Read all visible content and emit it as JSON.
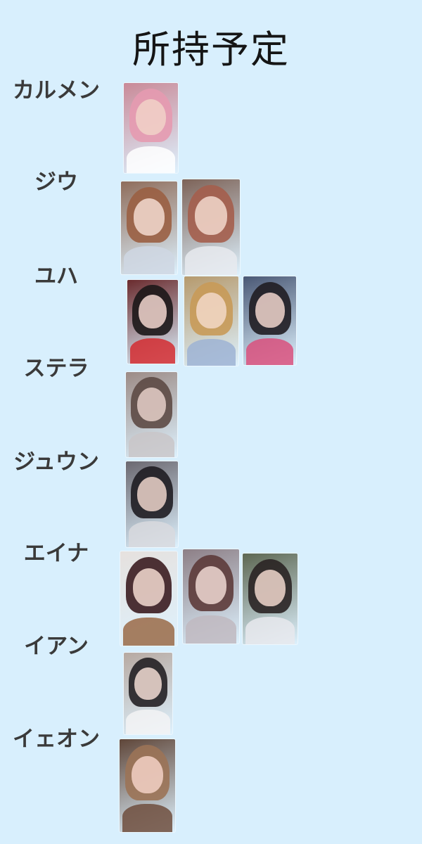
{
  "title": "所持予定",
  "members": [
    {
      "name": "カルメン",
      "cards": [
        {
          "bg": "#c98a98",
          "hair": "#e69ab0",
          "face": "#f1d2c8",
          "top": "#ffffff"
        }
      ]
    },
    {
      "name": "ジウ",
      "cards": [
        {
          "bg": "#8f6d5b",
          "hair": "#9a5f42",
          "face": "#f3dbd0",
          "top": "#cfd7e3"
        },
        {
          "bg": "#7d6358",
          "hair": "#a45e4c",
          "face": "#f2d8cd",
          "top": "#e8eaee"
        }
      ]
    },
    {
      "name": "ユハ",
      "cards": [
        {
          "bg": "#6a2b2e",
          "hair": "#1c1718",
          "face": "#f2d6cf",
          "top": "#d32b30"
        },
        {
          "bg": "#b69a6d",
          "hair": "#c89a58",
          "face": "#f2d8c8",
          "top": "#9db3d3"
        },
        {
          "bg": "#4a5875",
          "hair": "#201d22",
          "face": "#f0d5cd",
          "top": "#d9507d"
        }
      ]
    },
    {
      "name": "ステラ",
      "cards": [
        {
          "bg": "#9c8b86",
          "hair": "#5d4a45",
          "face": "#e5cfc8",
          "top": "#c9c6c8"
        }
      ]
    },
    {
      "name": "ジュウン",
      "cards": [
        {
          "bg": "#6b6870",
          "hair": "#1f1d22",
          "face": "#ecd3ca",
          "top": "#d8d9de"
        }
      ]
    },
    {
      "name": "エイナ",
      "cards": [
        {
          "bg": "#e6e1de",
          "hair": "#3b1c20",
          "face": "#f3dad1",
          "top": "#9a6a46"
        },
        {
          "bg": "#8d7f86",
          "hair": "#5d3b3a",
          "face": "#eed8d2",
          "top": "#bfb8bf"
        },
        {
          "bg": "#5d6752",
          "hair": "#2a2424",
          "face": "#f0d7cd",
          "top": "#e7e9ed"
        }
      ]
    },
    {
      "name": "イアン",
      "cards": [
        {
          "bg": "#b7a9a1",
          "hair": "#232024",
          "face": "#f2dcd4",
          "top": "#f3f3f5"
        }
      ]
    },
    {
      "name": "イェオン",
      "cards": [
        {
          "bg": "#5f4639",
          "hair": "#9b7357",
          "face": "#f3d1c6",
          "top": "#6f4e3d"
        }
      ]
    }
  ]
}
